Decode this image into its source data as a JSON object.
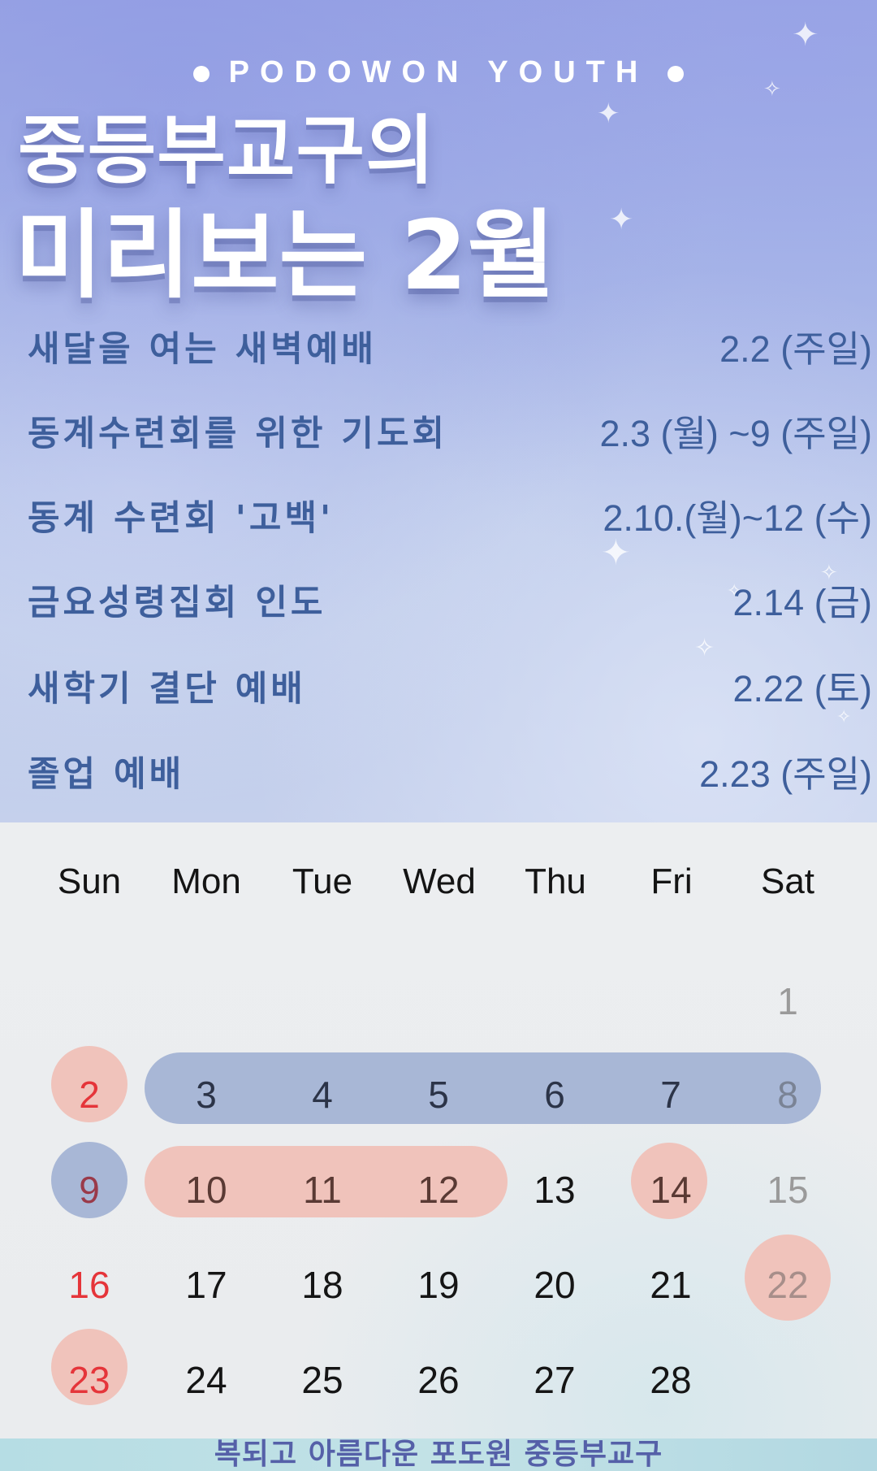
{
  "header": {
    "brand": "PODOWON YOUTH",
    "title_line1": "중등부교구의",
    "title_line2": "미리보는 2월"
  },
  "events": [
    {
      "name": "새달을 여는 새벽예배",
      "date": "2.2 (주일)"
    },
    {
      "name": "동계수련회를 위한 기도회",
      "date": "2.3 (월) ~9 (주일)"
    },
    {
      "name": "동계 수련회 '고백'",
      "date": "2.10.(월)~12 (수)"
    },
    {
      "name": "금요성령집회 인도",
      "date": "2.14 (금)"
    },
    {
      "name": "새학기 결단 예배",
      "date": "2.22 (토)"
    },
    {
      "name": "졸업 예배",
      "date": "2.23 (주일)"
    }
  ],
  "calendar": {
    "weekdays": [
      "Sun",
      "Mon",
      "Tue",
      "Wed",
      "Thu",
      "Fri",
      "Sat"
    ],
    "weeks": [
      [
        "",
        "",
        "",
        "",
        "",
        "",
        "1"
      ],
      [
        "2",
        "3",
        "4",
        "5",
        "6",
        "7",
        "8"
      ],
      [
        "9",
        "10",
        "11",
        "12",
        "13",
        "14",
        "15"
      ],
      [
        "16",
        "17",
        "18",
        "19",
        "20",
        "21",
        "22"
      ],
      [
        "23",
        "24",
        "25",
        "26",
        "27",
        "28",
        ""
      ]
    ]
  },
  "colors": {
    "highlight_blue": "#a8b7d6",
    "highlight_pink": "#f0c3bb",
    "sunday_red": "#e5353a",
    "saturday_gray": "#9a9a9a",
    "event_text": "#3e5f9c"
  },
  "footer": {
    "text": "복되고 아름다운 포도원 중등부교구"
  }
}
